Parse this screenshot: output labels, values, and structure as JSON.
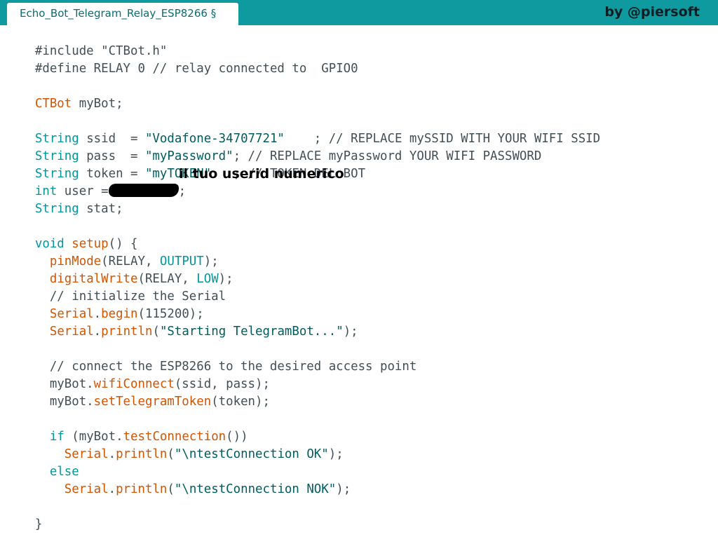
{
  "tab": {
    "title": "Echo_Bot_Telegram_Relay_ESP8266 §"
  },
  "brand": "by @piersoft",
  "annotation": "il tuo userid numerico",
  "code": {
    "l1": {
      "a": "#include \"CTBot.h\""
    },
    "l2": {
      "a": "#define RELAY ",
      "b": "0",
      "c": " // relay connected to  GPIO0"
    },
    "l3": {
      "a": "CTBot",
      "b": " myBot;"
    },
    "l4": {
      "a": "String",
      "b": " ssid  = ",
      "c": "\"Vodafone-34707721\"",
      "d": "    ; // REPLACE mySSID WITH YOUR WIFI SSID"
    },
    "l5": {
      "a": "String",
      "b": " pass  = ",
      "c": "\"myPassword\"",
      "d": "; // REPLACE myPassword YOUR WIFI PASSWORD"
    },
    "l6": {
      "a": "String",
      "b": " token = ",
      "c": "\"myTOKEN\"",
      "d": "   ; // TOKEN DEL BOT"
    },
    "l7": {
      "a": "int",
      "b": " user =",
      "c": ";"
    },
    "l8": {
      "a": "String",
      "b": " stat;"
    },
    "l9": {
      "a": "void",
      "b": " ",
      "c": "setup",
      "d": "() {"
    },
    "l10": {
      "a": "  ",
      "b": "pinMode",
      "c": "(RELAY, ",
      "d": "OUTPUT",
      "e": ");"
    },
    "l11": {
      "a": "  ",
      "b": "digitalWrite",
      "c": "(RELAY, ",
      "d": "LOW",
      "e": ");"
    },
    "l12": {
      "a": "  // initialize the Serial"
    },
    "l13": {
      "a": "  ",
      "b": "Serial",
      "c": ".",
      "d": "begin",
      "e": "(115200);"
    },
    "l14": {
      "a": "  ",
      "b": "Serial",
      "c": ".",
      "d": "println",
      "e": "(",
      "f": "\"Starting TelegramBot...\"",
      "g": ");"
    },
    "l15": {
      "a": "  // connect the ESP8266 to the desired access point"
    },
    "l16": {
      "a": "  myBot.",
      "b": "wifiConnect",
      "c": "(ssid, pass);"
    },
    "l17": {
      "a": "  myBot.",
      "b": "setTelegramToken",
      "c": "(token);"
    },
    "l18": {
      "a": "  ",
      "b": "if",
      "c": " (myBot.",
      "d": "testConnection",
      "e": "())"
    },
    "l19": {
      "a": "    ",
      "b": "Serial",
      "c": ".",
      "d": "println",
      "e": "(",
      "f": "\"\\ntestConnection OK\"",
      "g": ");"
    },
    "l20": {
      "a": "  ",
      "b": "else"
    },
    "l21": {
      "a": "    ",
      "b": "Serial",
      "c": ".",
      "d": "println",
      "e": "(",
      "f": "\"\\ntestConnection NOK\"",
      "g": ");"
    },
    "l22": {
      "a": "}"
    }
  },
  "colors": {
    "topbar": "#0f9aa0",
    "type_keyword": "#00979c",
    "function": "#d35400",
    "string": "#005c5f",
    "text": "#434f54"
  }
}
